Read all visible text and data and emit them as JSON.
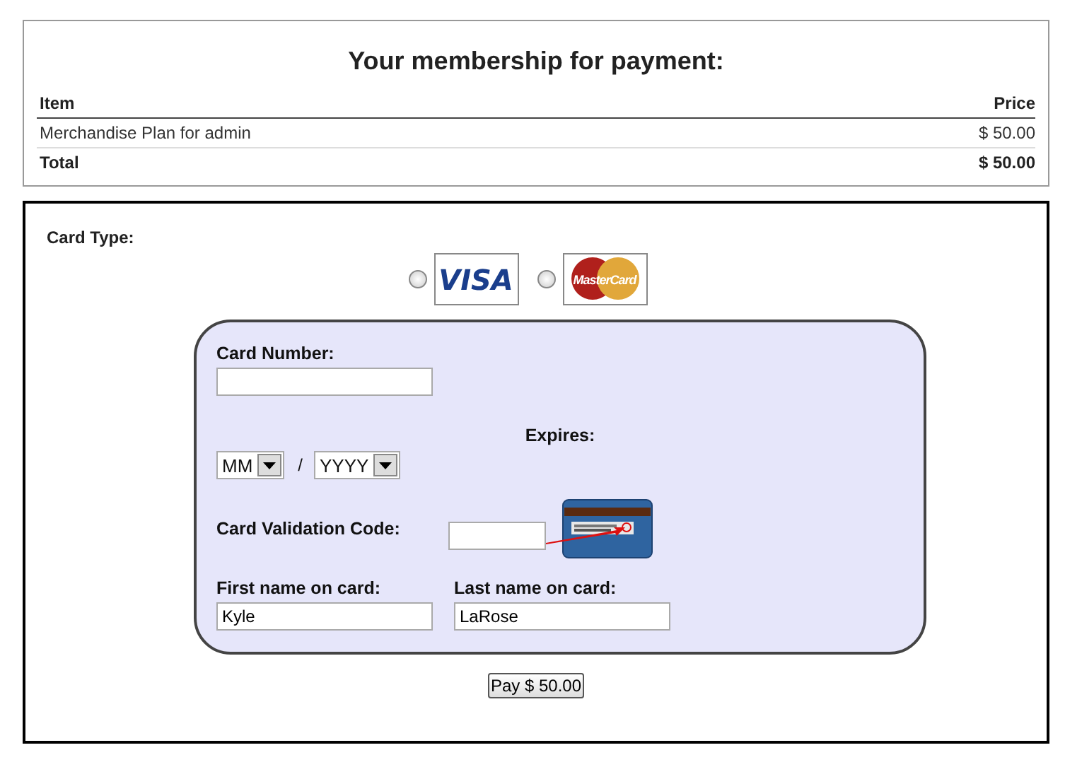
{
  "summary": {
    "title": "Your membership for payment:",
    "columns": [
      "Item",
      "Price"
    ],
    "rows": [
      {
        "item": "Merchandise Plan for admin",
        "price": "$ 50.00"
      }
    ],
    "total": {
      "label": "Total",
      "price": "$ 50.00"
    }
  },
  "payment": {
    "card_type_label": "Card Type:",
    "card_types": [
      {
        "kind": "visa",
        "logo_text": "VISA",
        "selected": false
      },
      {
        "kind": "mastercard",
        "logo_text": "MasterCard",
        "selected": false
      }
    ],
    "card_number": {
      "label": "Card Number:"
    },
    "expires": {
      "label": "Expires:",
      "month": "MM",
      "separator": "/",
      "year": "YYYY"
    },
    "cvc": {
      "label": "Card Validation Code:"
    },
    "first_name": {
      "label": "First name on card:",
      "value": "Kyle"
    },
    "last_name": {
      "label": "Last name on card:",
      "value": "LaRose"
    },
    "pay_button": "Pay $ 50.00"
  }
}
